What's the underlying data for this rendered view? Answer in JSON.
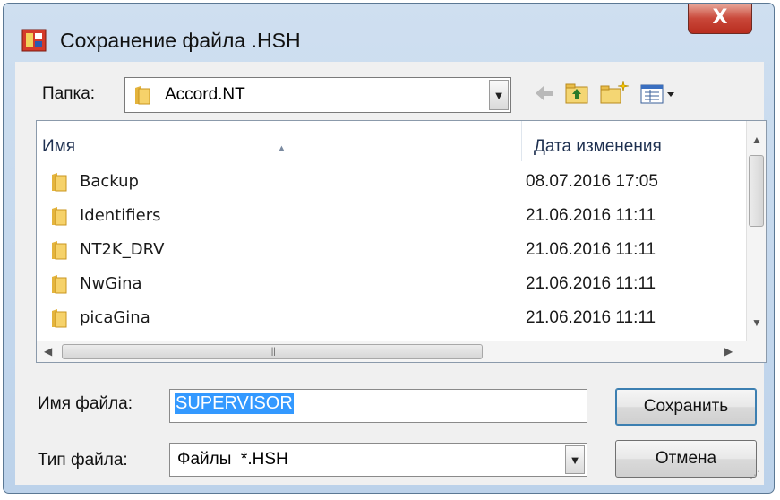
{
  "window": {
    "title": "Сохранение файла .HSH",
    "close_label": "X"
  },
  "lookin": {
    "label": "Папка:",
    "value": "Accord.NT"
  },
  "columns": {
    "name": "Имя",
    "date": "Дата изменения"
  },
  "files": [
    {
      "name": "Backup",
      "date": "08.07.2016 17:05"
    },
    {
      "name": "Identifiers",
      "date": "21.06.2016 11:11"
    },
    {
      "name": "NT2K_DRV",
      "date": "21.06.2016 11:11"
    },
    {
      "name": "NwGina",
      "date": "21.06.2016 11:11"
    },
    {
      "name": "picaGina",
      "date": "21.06.2016 11:11"
    }
  ],
  "filename": {
    "label": "Имя файла:",
    "value": "SUPERVISOR"
  },
  "filetype": {
    "label": "Тип файла:",
    "value": "Файлы  *.HSH"
  },
  "buttons": {
    "save": "Сохранить",
    "cancel": "Отмена"
  },
  "icons": [
    "app-icon",
    "folder-icon",
    "back-arrow-icon",
    "up-folder-icon",
    "new-folder-icon",
    "view-menu-icon"
  ]
}
